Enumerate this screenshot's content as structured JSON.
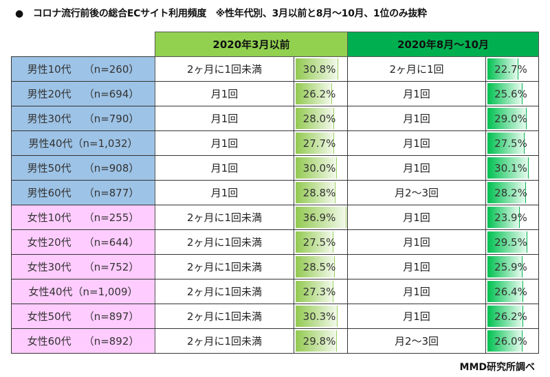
{
  "title": {
    "bullet": "●",
    "text": "コロナ流行前後の総合ECサイト利用頻度　※性年代別、3月以前と8月～10月、1位のみ抜粋"
  },
  "headers": {
    "period1": "2020年3月以前",
    "period2": "2020年8月～10月"
  },
  "colors": {
    "period1_header": "#92d050",
    "period2_header": "#00b050",
    "male_row": "#9dc3e6",
    "female_row": "#ffccff"
  },
  "bar_scale_max": 36.9,
  "rows": [
    {
      "group": "男性10代",
      "n": "（n=260）",
      "gender": "male",
      "p1_freq": "2ヶ月に1回未満",
      "p1_pct": 30.8,
      "p1_label": "30.8%",
      "p2_freq": "2ヶ月に1回",
      "p2_pct": 22.7,
      "p2_label": "22.7%"
    },
    {
      "group": "男性20代",
      "n": "（n=694）",
      "gender": "male",
      "p1_freq": "月1回",
      "p1_pct": 26.2,
      "p1_label": "26.2%",
      "p2_freq": "月1回",
      "p2_pct": 25.6,
      "p2_label": "25.6%"
    },
    {
      "group": "男性30代",
      "n": "（n=790）",
      "gender": "male",
      "p1_freq": "月1回",
      "p1_pct": 28.0,
      "p1_label": "28.0%",
      "p2_freq": "月1回",
      "p2_pct": 29.0,
      "p2_label": "29.0%"
    },
    {
      "group": "男性40代",
      "n": "（n=1,032）",
      "gender": "male",
      "p1_freq": "月1回",
      "p1_pct": 27.7,
      "p1_label": "27.7%",
      "p2_freq": "月1回",
      "p2_pct": 27.5,
      "p2_label": "27.5%"
    },
    {
      "group": "男性50代",
      "n": "（n=908）",
      "gender": "male",
      "p1_freq": "月1回",
      "p1_pct": 30.0,
      "p1_label": "30.0%",
      "p2_freq": "月1回",
      "p2_pct": 30.1,
      "p2_label": "30.1%"
    },
    {
      "group": "男性60代",
      "n": "（n=877）",
      "gender": "male",
      "p1_freq": "月1回",
      "p1_pct": 28.8,
      "p1_label": "28.8%",
      "p2_freq": "月2～3回",
      "p2_pct": 28.2,
      "p2_label": "28.2%"
    },
    {
      "group": "女性10代",
      "n": "（n=255）",
      "gender": "female",
      "p1_freq": "2ヶ月に1回未満",
      "p1_pct": 36.9,
      "p1_label": "36.9%",
      "p2_freq": "月1回",
      "p2_pct": 23.9,
      "p2_label": "23.9%"
    },
    {
      "group": "女性20代",
      "n": "（n=644）",
      "gender": "female",
      "p1_freq": "2ヶ月に1回未満",
      "p1_pct": 27.5,
      "p1_label": "27.5%",
      "p2_freq": "月1回",
      "p2_pct": 29.5,
      "p2_label": "29.5%"
    },
    {
      "group": "女性30代",
      "n": "（n=752）",
      "gender": "female",
      "p1_freq": "2ヶ月に1回未満",
      "p1_pct": 28.5,
      "p1_label": "28.5%",
      "p2_freq": "月1回",
      "p2_pct": 25.9,
      "p2_label": "25.9%"
    },
    {
      "group": "女性40代",
      "n": "（n=1,009）",
      "gender": "female",
      "p1_freq": "2ヶ月に1回未満",
      "p1_pct": 27.3,
      "p1_label": "27.3%",
      "p2_freq": "月1回",
      "p2_pct": 26.4,
      "p2_label": "26.4%"
    },
    {
      "group": "女性50代",
      "n": "（n=897）",
      "gender": "female",
      "p1_freq": "2ヶ月に1回未満",
      "p1_pct": 30.3,
      "p1_label": "30.3%",
      "p2_freq": "月1回",
      "p2_pct": 26.2,
      "p2_label": "26.2%"
    },
    {
      "group": "女性60代",
      "n": "（n=892）",
      "gender": "female",
      "p1_freq": "2ヶ月に1回未満",
      "p1_pct": 29.8,
      "p1_label": "29.8%",
      "p2_freq": "月2～3回",
      "p2_pct": 26.0,
      "p2_label": "26.0%"
    }
  ],
  "source": "MMD研究所調べ"
}
